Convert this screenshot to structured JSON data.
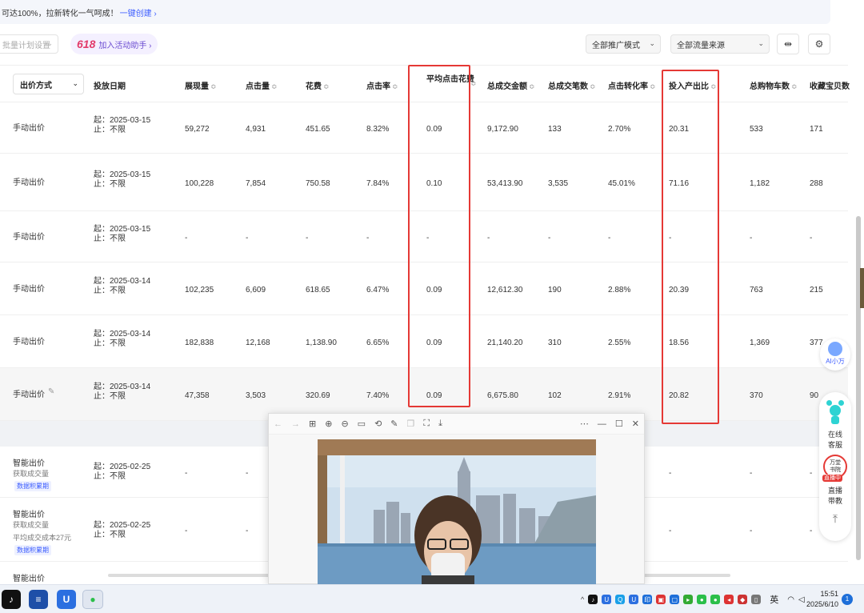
{
  "banner": {
    "text": "可达100%，拉新转化一气呵成！",
    "link": "一键创建 ›"
  },
  "toolbar": {
    "batch_label": "批量计划设置",
    "promo_618": "618",
    "promo_label": "加入活动助手 ›",
    "mode_select": "全部推广模式",
    "source_select": "全部流量来源"
  },
  "table": {
    "bid_type_header": "出价方式",
    "columns": [
      "投放日期",
      "展现量",
      "点击量",
      "花费",
      "点击率",
      "平均点击花费",
      "总成交金额",
      "总成交笔数",
      "点击转化率",
      "投入产出比",
      "总购物车数",
      "收藏宝贝数"
    ],
    "rows": [
      {
        "bid": "手动出价",
        "start": "起：2025-03-15",
        "end": "止：不限",
        "v": [
          "59,272",
          "4,931",
          "451.65",
          "8.32%",
          "0.09",
          "9,172.90",
          "133",
          "2.70%",
          "20.31",
          "533",
          "171"
        ]
      },
      {
        "bid": "手动出价",
        "start": "起：2025-03-15",
        "end": "止：不限",
        "v": [
          "100,228",
          "7,854",
          "750.58",
          "7.84%",
          "0.10",
          "53,413.90",
          "3,535",
          "45.01%",
          "71.16",
          "1,182",
          "288"
        ]
      },
      {
        "bid": "手动出价",
        "start": "起：2025-03-15",
        "end": "止：不限",
        "v": [
          "-",
          "-",
          "-",
          "-",
          "-",
          "-",
          "-",
          "-",
          "-",
          "-",
          "-"
        ]
      },
      {
        "bid": "手动出价",
        "start": "起：2025-03-14",
        "end": "止：不限",
        "v": [
          "102,235",
          "6,609",
          "618.65",
          "6.47%",
          "0.09",
          "12,612.30",
          "190",
          "2.88%",
          "20.39",
          "763",
          "215"
        ]
      },
      {
        "bid": "手动出价",
        "start": "起：2025-03-14",
        "end": "止：不限",
        "v": [
          "182,838",
          "12,168",
          "1,138.90",
          "6.65%",
          "0.09",
          "21,140.20",
          "310",
          "2.55%",
          "18.56",
          "1,369",
          "377"
        ]
      },
      {
        "bid": "手动出价",
        "start": "起：2025-03-14",
        "end": "止：不限",
        "v": [
          "47,358",
          "3,503",
          "320.69",
          "7.40%",
          "0.09",
          "6,675.80",
          "102",
          "2.91%",
          "20.82",
          "370",
          "90"
        ]
      }
    ],
    "smart_rows": [
      {
        "bid": "智能出价",
        "sub1": "获取成交量",
        "sub2": "",
        "tag": "数据积累期",
        "start": "起：2025-02-25",
        "end": "止：不限",
        "dash": "-"
      },
      {
        "bid": "智能出价",
        "sub1": "获取成交量",
        "sub2": "平均成交成本27元",
        "tag": "数据积累期",
        "start": "起：2025-02-25",
        "end": "止：不限",
        "dash": "-"
      },
      {
        "bid": "智能出价"
      }
    ]
  },
  "float": {
    "ai_label": "AI小万",
    "service_1": "在线",
    "service_2": "客服",
    "live_1": "万堂",
    "live_2": "书院",
    "live_badge": "直播中",
    "live_label_1": "直播",
    "live_label_2": "带教"
  },
  "taskbar": {
    "ime": "英",
    "time": "15:51",
    "date": "2025/6/10",
    "notifications": "1"
  }
}
